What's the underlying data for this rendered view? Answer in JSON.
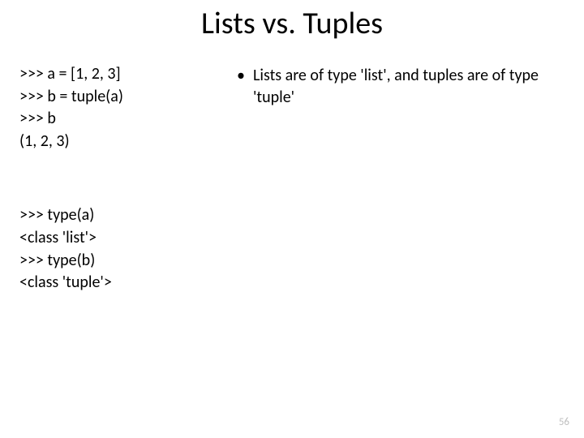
{
  "title": "Lists vs. Tuples",
  "code": {
    "block1": {
      "l1": ">>> a = [1, 2, 3]",
      "l2": ">>> b = tuple(a)",
      "l3": ">>> b",
      "l4": "(1, 2, 3)"
    },
    "block2": {
      "l1": ">>> type(a)",
      "l2": "<class 'list'>",
      "l3": ">>> type(b)",
      "l4": "<class 'tuple'>"
    }
  },
  "bullet": {
    "dot": "•",
    "text": "Lists are of type 'list', and tuples are of type 'tuple'"
  },
  "pageNumber": "56"
}
